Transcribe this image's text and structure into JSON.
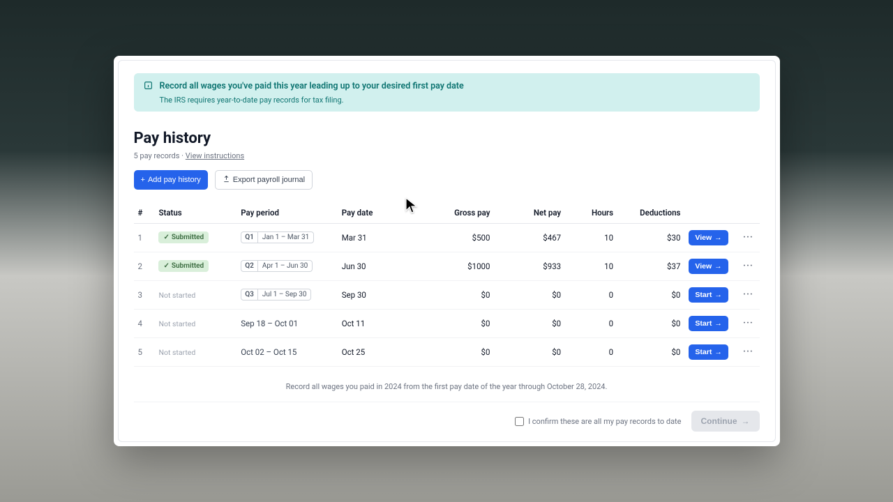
{
  "banner": {
    "title": "Record all wages you've paid this year leading up to your desired first pay date",
    "subtitle": "The IRS requires year-to-date pay records for tax filing."
  },
  "page": {
    "title": "Pay history",
    "record_count": "5 pay records",
    "view_instructions": "View instructions"
  },
  "actions": {
    "add": "Add pay history",
    "export": "Export payroll journal"
  },
  "columns": {
    "num": "#",
    "status": "Status",
    "period": "Pay period",
    "paydate": "Pay date",
    "gross": "Gross pay",
    "net": "Net pay",
    "hours": "Hours",
    "deductions": "Deductions"
  },
  "status_labels": {
    "submitted": "Submitted",
    "not_started": "Not started"
  },
  "row_buttons": {
    "view": "View",
    "start": "Start"
  },
  "rows": [
    {
      "n": "1",
      "status": "submitted",
      "q": "Q1",
      "range": "Jan 1 – Mar 31",
      "chip": true,
      "paydate": "Mar 31",
      "gross": "$500",
      "net": "$467",
      "hours": "10",
      "ded": "$30",
      "btn": "view"
    },
    {
      "n": "2",
      "status": "submitted",
      "q": "Q2",
      "range": "Apr 1 – Jun 30",
      "chip": true,
      "paydate": "Jun 30",
      "gross": "$1000",
      "net": "$933",
      "hours": "10",
      "ded": "$37",
      "btn": "view"
    },
    {
      "n": "3",
      "status": "not_started",
      "q": "Q3",
      "range": "Jul 1 – Sep 30",
      "chip": true,
      "paydate": "Sep 30",
      "gross": "$0",
      "net": "$0",
      "hours": "0",
      "ded": "$0",
      "btn": "start"
    },
    {
      "n": "4",
      "status": "not_started",
      "q": "",
      "range": "Sep 18 – Oct 01",
      "chip": false,
      "paydate": "Oct 11",
      "gross": "$0",
      "net": "$0",
      "hours": "0",
      "ded": "$0",
      "btn": "start"
    },
    {
      "n": "5",
      "status": "not_started",
      "q": "",
      "range": "Oct 02 – Oct 15",
      "chip": false,
      "paydate": "Oct 25",
      "gross": "$0",
      "net": "$0",
      "hours": "0",
      "ded": "$0",
      "btn": "start"
    }
  ],
  "footnote": "Record all wages you paid in 2024 from the first pay date of the year through October 28, 2024.",
  "footer": {
    "confirm_label": "I confirm these are all my pay records to date",
    "continue": "Continue"
  }
}
